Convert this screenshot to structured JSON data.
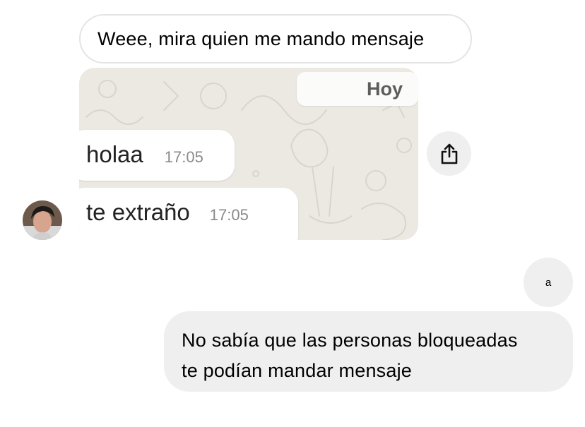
{
  "conversation": {
    "incoming": {
      "text": "Weee, mira quien me mando mensaje",
      "shared_screenshot": {
        "date_label": "Hoy",
        "messages": [
          {
            "text": "holaa",
            "time": "17:05"
          },
          {
            "text": "te extraño",
            "time": "17:05"
          }
        ]
      }
    },
    "outgoing": {
      "short_text": "a",
      "text_line1": "No sabía que las personas bloqueadas",
      "text_line2": "te podían mandar mensaje"
    }
  },
  "icons": {
    "share": "share-icon",
    "avatar": "avatar-icon"
  },
  "colors": {
    "bubble_gray": "#efefef",
    "wallpaper": "#ece9e3"
  }
}
